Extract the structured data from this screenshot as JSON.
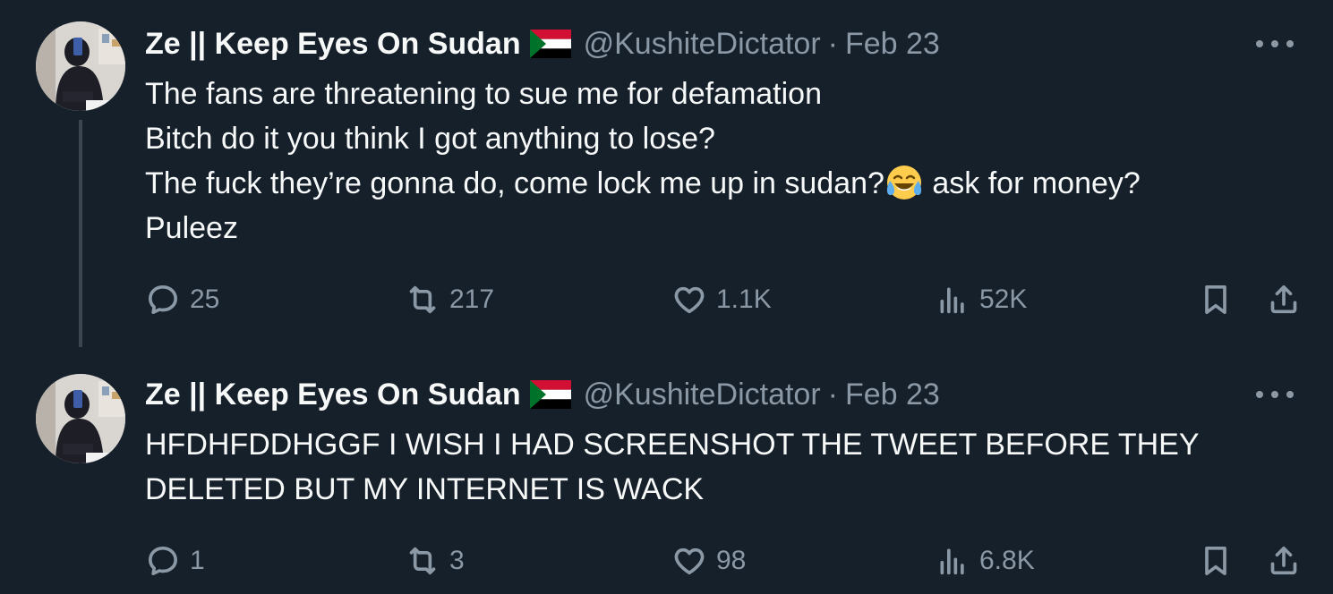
{
  "tweets": [
    {
      "author": {
        "name": "Ze || Keep Eyes On Sudan",
        "flag_icon": "sudan-flag-icon",
        "handle": "@KushiteDictator",
        "separator": "·",
        "date": "Feb 23"
      },
      "text_lines": [
        "The fans are  threatening to sue me for defamation",
        "Bitch do it you think I got anything to lose?",
        "The fuck they’re gonna do, come lock me up in sudan?",
        "Puleez"
      ],
      "emoji_after_line_3": "😂",
      "text_after_emoji": " ask for money?",
      "stats": {
        "replies": "25",
        "reposts": "217",
        "likes": "1.1K",
        "views": "52K"
      }
    },
    {
      "author": {
        "name": "Ze || Keep Eyes On Sudan",
        "flag_icon": "sudan-flag-icon",
        "handle": "@KushiteDictator",
        "separator": "·",
        "date": "Feb 23"
      },
      "text_lines": [
        "HFDHFDDHGGF I WISH I HAD SCREENSHOT THE TWEET BEFORE THEY",
        "DELETED BUT MY INTERNET IS WACK"
      ],
      "stats": {
        "replies": "1",
        "reposts": "3",
        "likes": "98",
        "views": "6.8K"
      }
    }
  ],
  "colors": {
    "background": "#15202b",
    "text_primary": "#f7f9f9",
    "text_secondary": "#8b98a5",
    "thread_line": "#3c4650"
  }
}
